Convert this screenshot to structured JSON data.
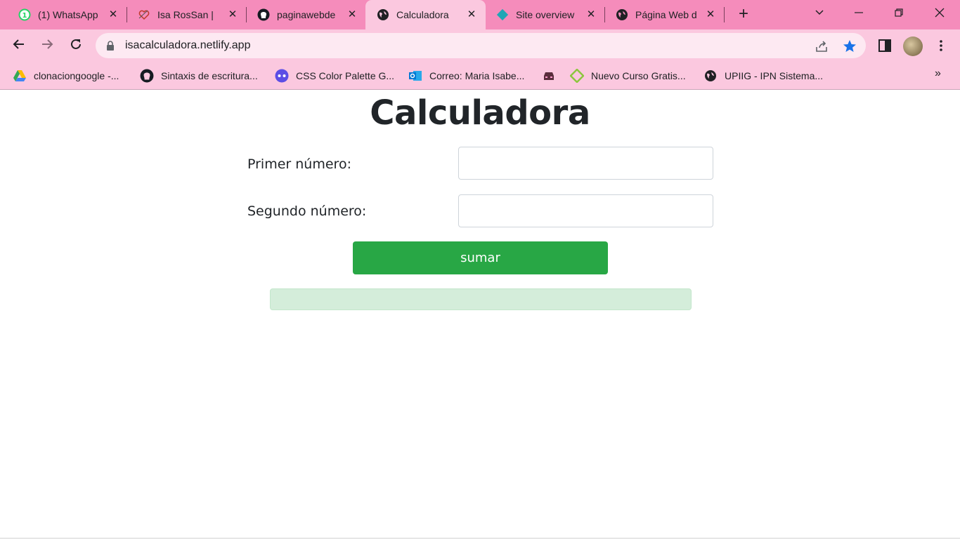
{
  "browser": {
    "tabs": [
      {
        "title": "(1) WhatsApp",
        "icon": "whatsapp-icon"
      },
      {
        "title": "Isa RosSan | D",
        "icon": "heart-doodle-icon"
      },
      {
        "title": "paginawebde",
        "icon": "github-icon"
      },
      {
        "title": "Calculadora",
        "icon": "globe-icon",
        "active": true
      },
      {
        "title": "Site overview",
        "icon": "netlify-icon"
      },
      {
        "title": "Página Web d",
        "icon": "globe-icon"
      }
    ],
    "whatsapp_badge": "1",
    "new_tab_symbol": "+",
    "url": "isacalculadora.netlify.app",
    "bookmarks": [
      {
        "label": "clonaciongoogle -...",
        "icon": "google-drive-icon"
      },
      {
        "label": "Sintaxis de escritura...",
        "icon": "github-icon"
      },
      {
        "label": "CSS Color Palette G...",
        "icon": "palette-icon"
      },
      {
        "label": "Correo: Maria Isabe...",
        "icon": "outlook-icon"
      },
      {
        "label": "",
        "icon": "car-icon"
      },
      {
        "label": "Nuevo Curso Gratis...",
        "icon": "diamond-icon"
      },
      {
        "label": "UPIIG - IPN Sistema...",
        "icon": "globe-icon"
      }
    ],
    "more_bookmarks": "»",
    "colors": {
      "frame": "#f58cbb",
      "toolbar": "#fbc8df",
      "omnibox": "#fde9f2"
    }
  },
  "page": {
    "title": "Calculadora",
    "first_label": "Primer número:",
    "first_value": "",
    "second_label": "Segundo número:",
    "second_value": "",
    "button_label": "sumar",
    "result": "",
    "colors": {
      "button": "#28a745",
      "result_bg": "#d4edda"
    }
  }
}
